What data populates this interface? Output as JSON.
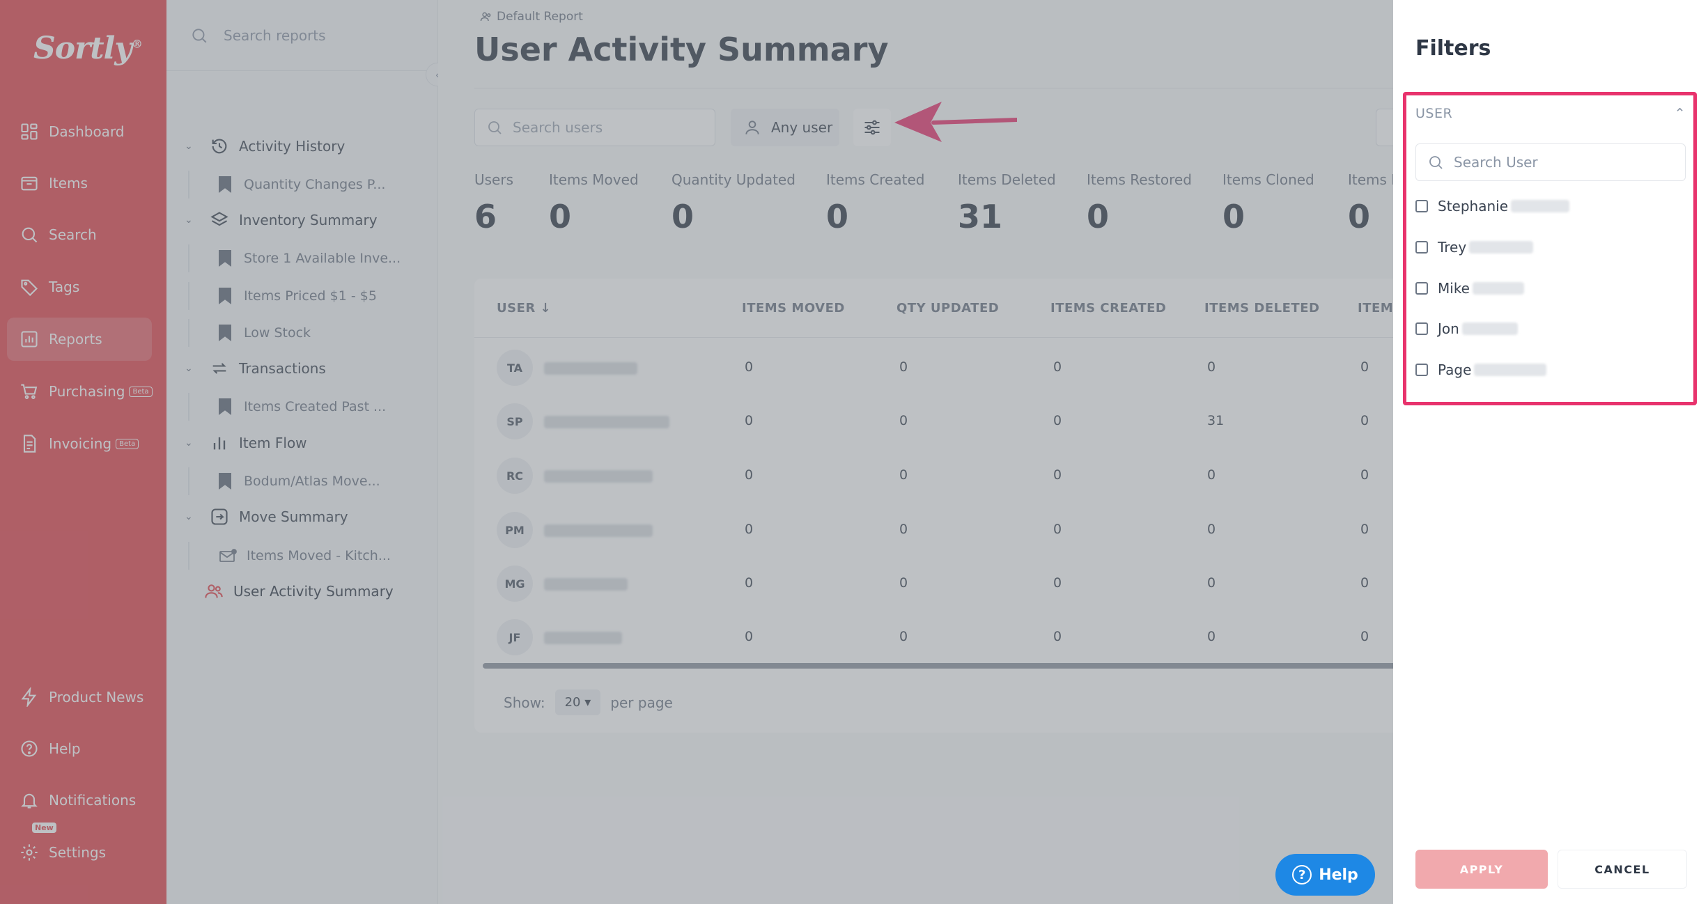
{
  "brand": {
    "name": "Sortly",
    "mark": "®",
    "accent": "#e2434c"
  },
  "sidebar": {
    "items": [
      {
        "label": "Dashboard",
        "icon": "dashboard-icon"
      },
      {
        "label": "Items",
        "icon": "folder-icon"
      },
      {
        "label": "Search",
        "icon": "search-icon"
      },
      {
        "label": "Tags",
        "icon": "tag-icon"
      },
      {
        "label": "Reports",
        "icon": "reports-icon",
        "active": true
      },
      {
        "label": "Purchasing",
        "icon": "cart-icon",
        "badge": "Beta"
      },
      {
        "label": "Invoicing",
        "icon": "invoice-icon",
        "badge": "Beta"
      }
    ],
    "bottom": [
      {
        "label": "Product News",
        "icon": "bolt-icon"
      },
      {
        "label": "Help",
        "icon": "help-icon"
      },
      {
        "label": "Notifications",
        "icon": "bell-icon"
      },
      {
        "label": "Settings",
        "icon": "gear-icon",
        "badge": "New"
      }
    ]
  },
  "reports_nav": {
    "search_placeholder": "Search reports",
    "groups": [
      {
        "label": "Activity History",
        "children": [
          "Quantity Changes P..."
        ]
      },
      {
        "label": "Inventory Summary",
        "children": [
          "Store 1 Available Inve...",
          "Items Priced $1 - $5",
          "Low Stock"
        ]
      },
      {
        "label": "Transactions",
        "children": [
          "Items Created Past ..."
        ]
      },
      {
        "label": "Item Flow",
        "children": [
          "Bodum/Atlas Move..."
        ]
      },
      {
        "label": "Move Summary",
        "children": [
          "Items Moved - Kitch..."
        ]
      }
    ],
    "current": "User Activity Summary"
  },
  "main": {
    "breadcrumb": "Default Report",
    "title": "User Activity Summary",
    "search_placeholder": "Search users",
    "any_user": "Any user",
    "stats": [
      {
        "label": "Users",
        "value": "6"
      },
      {
        "label": "Items Moved",
        "value": "0"
      },
      {
        "label": "Quantity Updated",
        "value": "0"
      },
      {
        "label": "Items Created",
        "value": "0"
      },
      {
        "label": "Items Deleted",
        "value": "31"
      },
      {
        "label": "Items Restored",
        "value": "0"
      },
      {
        "label": "Items Cloned",
        "value": "0"
      },
      {
        "label": "Items M",
        "value": "0"
      }
    ],
    "table": {
      "headers": [
        "USER",
        "ITEMS MOVED",
        "QTY UPDATED",
        "ITEMS CREATED",
        "ITEMS DELETED",
        "ITEMS"
      ],
      "sort_arrow": "↓",
      "rows": [
        {
          "initials": "TA",
          "cells": [
            "0",
            "0",
            "0",
            "0",
            "0"
          ]
        },
        {
          "initials": "SP",
          "cells": [
            "0",
            "0",
            "0",
            "31",
            "0"
          ]
        },
        {
          "initials": "RC",
          "cells": [
            "0",
            "0",
            "0",
            "0",
            "0"
          ]
        },
        {
          "initials": "PM",
          "cells": [
            "0",
            "0",
            "0",
            "0",
            "0"
          ]
        },
        {
          "initials": "MG",
          "cells": [
            "0",
            "0",
            "0",
            "0",
            "0"
          ]
        },
        {
          "initials": "JF",
          "cells": [
            "0",
            "0",
            "0",
            "0",
            "0"
          ]
        }
      ]
    },
    "pager": {
      "show": "Show:",
      "per_page_value": "20",
      "per_page": "per page"
    },
    "help_button": "Help"
  },
  "filters": {
    "title": "Filters",
    "section": "USER",
    "search_placeholder": "Search User",
    "users": [
      "Stephanie",
      "Trey",
      "Mike",
      "Jon",
      "Page"
    ],
    "apply": "APPLY",
    "cancel": "CANCEL",
    "highlight_color": "#e8336d"
  }
}
